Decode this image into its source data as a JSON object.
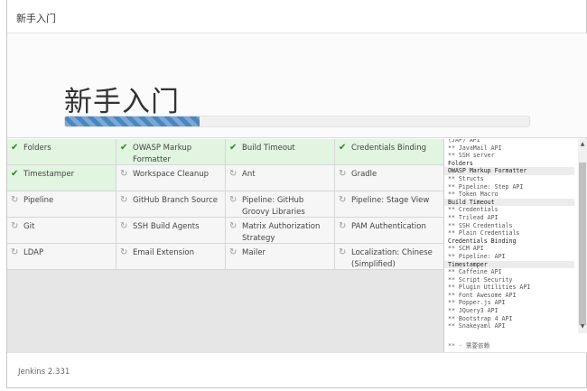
{
  "header": {
    "title": "新手入门"
  },
  "hero": {
    "title": "新手入门",
    "progress_fraction": 0.29
  },
  "plugins": [
    {
      "name": "Folders",
      "status": "done"
    },
    {
      "name": "OWASP Markup Formatter",
      "status": "done"
    },
    {
      "name": "Build Timeout",
      "status": "done"
    },
    {
      "name": "Credentials Binding",
      "status": "done"
    },
    {
      "name": "Timestamper",
      "status": "done"
    },
    {
      "name": "Workspace Cleanup",
      "status": "pending"
    },
    {
      "name": "Ant",
      "status": "pending"
    },
    {
      "name": "Gradle",
      "status": "pending"
    },
    {
      "name": "Pipeline",
      "status": "pending"
    },
    {
      "name": "GitHub Branch Source",
      "status": "pending"
    },
    {
      "name": "Pipeline: GitHub Groovy Libraries",
      "status": "pending"
    },
    {
      "name": "Pipeline: Stage View",
      "status": "pending"
    },
    {
      "name": "Git",
      "status": "pending"
    },
    {
      "name": "SSH Build Agents",
      "status": "pending"
    },
    {
      "name": "Matrix Authorization Strategy",
      "status": "pending"
    },
    {
      "name": "PAM Authentication",
      "status": "pending"
    },
    {
      "name": "LDAP",
      "status": "pending"
    },
    {
      "name": "Email Extension",
      "status": "pending"
    },
    {
      "name": "Mailer",
      "status": "pending"
    },
    {
      "name": "Localization: Chinese (Simplified)",
      "status": "pending"
    }
  ],
  "icons": {
    "done": "check-icon",
    "pending": "refresh-icon"
  },
  "log": {
    "lines": [
      {
        "text": "(JAF) API",
        "kind": "dep"
      },
      {
        "text": "** JavaMail API",
        "kind": "dep"
      },
      {
        "text": "** SSH server",
        "kind": "dep"
      },
      {
        "text": "Folders",
        "kind": "head"
      },
      {
        "text": "OWASP Markup Formatter",
        "kind": "head-band"
      },
      {
        "text": "** Structs",
        "kind": "dep"
      },
      {
        "text": "** Pipeline: Step API",
        "kind": "dep"
      },
      {
        "text": "** Token Macro",
        "kind": "dep"
      },
      {
        "text": "Build Timeout",
        "kind": "head-band"
      },
      {
        "text": "** Credentials",
        "kind": "dep"
      },
      {
        "text": "** Trilead API",
        "kind": "dep"
      },
      {
        "text": "** SSH Credentials",
        "kind": "dep"
      },
      {
        "text": "** Plain Credentials",
        "kind": "dep"
      },
      {
        "text": "Credentials Binding",
        "kind": "head"
      },
      {
        "text": "** SCM API",
        "kind": "dep"
      },
      {
        "text": "** Pipeline: API",
        "kind": "dep"
      },
      {
        "text": "Timestamper",
        "kind": "head-band"
      },
      {
        "text": "** Caffeine API",
        "kind": "dep"
      },
      {
        "text": "** Script Security",
        "kind": "dep"
      },
      {
        "text": "** Plugin Utilities API",
        "kind": "dep"
      },
      {
        "text": "** Font Awesome API",
        "kind": "dep"
      },
      {
        "text": "** Popper.js API",
        "kind": "dep"
      },
      {
        "text": "** JQuery3 API",
        "kind": "dep"
      },
      {
        "text": "** Bootstrap 4 API",
        "kind": "dep"
      },
      {
        "text": "** Snakeyaml API",
        "kind": "dep"
      }
    ],
    "legend": "** - 需要依赖"
  },
  "footer": {
    "version": "Jenkins 2.331"
  },
  "colors": {
    "done_bg": "#e1f5e0",
    "check": "#2f7d32",
    "progress": "#4a87c2"
  }
}
